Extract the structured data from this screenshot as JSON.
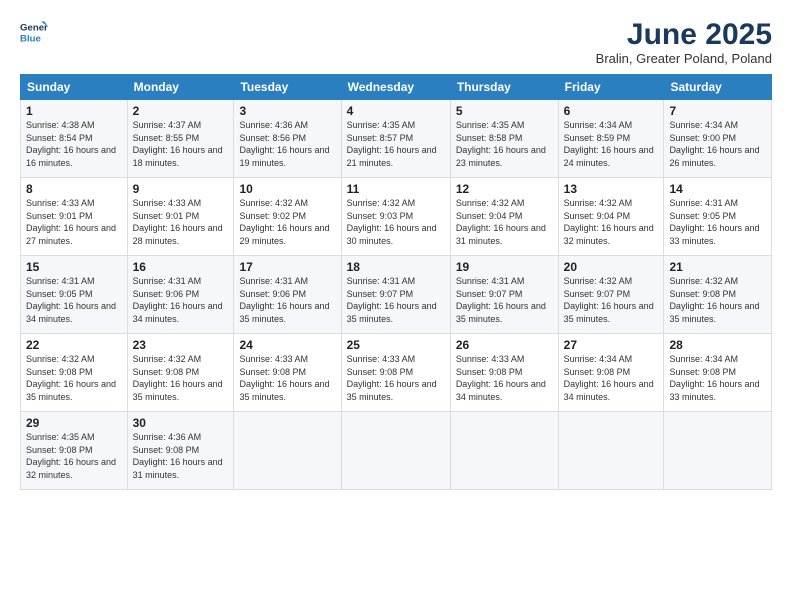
{
  "logo": {
    "line1": "General",
    "line2": "Blue"
  },
  "title": "June 2025",
  "subtitle": "Bralin, Greater Poland, Poland",
  "weekdays": [
    "Sunday",
    "Monday",
    "Tuesday",
    "Wednesday",
    "Thursday",
    "Friday",
    "Saturday"
  ],
  "weeks": [
    [
      {
        "day": "1",
        "sunrise": "Sunrise: 4:38 AM",
        "sunset": "Sunset: 8:54 PM",
        "daylight": "Daylight: 16 hours and 16 minutes."
      },
      {
        "day": "2",
        "sunrise": "Sunrise: 4:37 AM",
        "sunset": "Sunset: 8:55 PM",
        "daylight": "Daylight: 16 hours and 18 minutes."
      },
      {
        "day": "3",
        "sunrise": "Sunrise: 4:36 AM",
        "sunset": "Sunset: 8:56 PM",
        "daylight": "Daylight: 16 hours and 19 minutes."
      },
      {
        "day": "4",
        "sunrise": "Sunrise: 4:35 AM",
        "sunset": "Sunset: 8:57 PM",
        "daylight": "Daylight: 16 hours and 21 minutes."
      },
      {
        "day": "5",
        "sunrise": "Sunrise: 4:35 AM",
        "sunset": "Sunset: 8:58 PM",
        "daylight": "Daylight: 16 hours and 23 minutes."
      },
      {
        "day": "6",
        "sunrise": "Sunrise: 4:34 AM",
        "sunset": "Sunset: 8:59 PM",
        "daylight": "Daylight: 16 hours and 24 minutes."
      },
      {
        "day": "7",
        "sunrise": "Sunrise: 4:34 AM",
        "sunset": "Sunset: 9:00 PM",
        "daylight": "Daylight: 16 hours and 26 minutes."
      }
    ],
    [
      {
        "day": "8",
        "sunrise": "Sunrise: 4:33 AM",
        "sunset": "Sunset: 9:01 PM",
        "daylight": "Daylight: 16 hours and 27 minutes."
      },
      {
        "day": "9",
        "sunrise": "Sunrise: 4:33 AM",
        "sunset": "Sunset: 9:01 PM",
        "daylight": "Daylight: 16 hours and 28 minutes."
      },
      {
        "day": "10",
        "sunrise": "Sunrise: 4:32 AM",
        "sunset": "Sunset: 9:02 PM",
        "daylight": "Daylight: 16 hours and 29 minutes."
      },
      {
        "day": "11",
        "sunrise": "Sunrise: 4:32 AM",
        "sunset": "Sunset: 9:03 PM",
        "daylight": "Daylight: 16 hours and 30 minutes."
      },
      {
        "day": "12",
        "sunrise": "Sunrise: 4:32 AM",
        "sunset": "Sunset: 9:04 PM",
        "daylight": "Daylight: 16 hours and 31 minutes."
      },
      {
        "day": "13",
        "sunrise": "Sunrise: 4:32 AM",
        "sunset": "Sunset: 9:04 PM",
        "daylight": "Daylight: 16 hours and 32 minutes."
      },
      {
        "day": "14",
        "sunrise": "Sunrise: 4:31 AM",
        "sunset": "Sunset: 9:05 PM",
        "daylight": "Daylight: 16 hours and 33 minutes."
      }
    ],
    [
      {
        "day": "15",
        "sunrise": "Sunrise: 4:31 AM",
        "sunset": "Sunset: 9:05 PM",
        "daylight": "Daylight: 16 hours and 34 minutes."
      },
      {
        "day": "16",
        "sunrise": "Sunrise: 4:31 AM",
        "sunset": "Sunset: 9:06 PM",
        "daylight": "Daylight: 16 hours and 34 minutes."
      },
      {
        "day": "17",
        "sunrise": "Sunrise: 4:31 AM",
        "sunset": "Sunset: 9:06 PM",
        "daylight": "Daylight: 16 hours and 35 minutes."
      },
      {
        "day": "18",
        "sunrise": "Sunrise: 4:31 AM",
        "sunset": "Sunset: 9:07 PM",
        "daylight": "Daylight: 16 hours and 35 minutes."
      },
      {
        "day": "19",
        "sunrise": "Sunrise: 4:31 AM",
        "sunset": "Sunset: 9:07 PM",
        "daylight": "Daylight: 16 hours and 35 minutes."
      },
      {
        "day": "20",
        "sunrise": "Sunrise: 4:32 AM",
        "sunset": "Sunset: 9:07 PM",
        "daylight": "Daylight: 16 hours and 35 minutes."
      },
      {
        "day": "21",
        "sunrise": "Sunrise: 4:32 AM",
        "sunset": "Sunset: 9:08 PM",
        "daylight": "Daylight: 16 hours and 35 minutes."
      }
    ],
    [
      {
        "day": "22",
        "sunrise": "Sunrise: 4:32 AM",
        "sunset": "Sunset: 9:08 PM",
        "daylight": "Daylight: 16 hours and 35 minutes."
      },
      {
        "day": "23",
        "sunrise": "Sunrise: 4:32 AM",
        "sunset": "Sunset: 9:08 PM",
        "daylight": "Daylight: 16 hours and 35 minutes."
      },
      {
        "day": "24",
        "sunrise": "Sunrise: 4:33 AM",
        "sunset": "Sunset: 9:08 PM",
        "daylight": "Daylight: 16 hours and 35 minutes."
      },
      {
        "day": "25",
        "sunrise": "Sunrise: 4:33 AM",
        "sunset": "Sunset: 9:08 PM",
        "daylight": "Daylight: 16 hours and 35 minutes."
      },
      {
        "day": "26",
        "sunrise": "Sunrise: 4:33 AM",
        "sunset": "Sunset: 9:08 PM",
        "daylight": "Daylight: 16 hours and 34 minutes."
      },
      {
        "day": "27",
        "sunrise": "Sunrise: 4:34 AM",
        "sunset": "Sunset: 9:08 PM",
        "daylight": "Daylight: 16 hours and 34 minutes."
      },
      {
        "day": "28",
        "sunrise": "Sunrise: 4:34 AM",
        "sunset": "Sunset: 9:08 PM",
        "daylight": "Daylight: 16 hours and 33 minutes."
      }
    ],
    [
      {
        "day": "29",
        "sunrise": "Sunrise: 4:35 AM",
        "sunset": "Sunset: 9:08 PM",
        "daylight": "Daylight: 16 hours and 32 minutes."
      },
      {
        "day": "30",
        "sunrise": "Sunrise: 4:36 AM",
        "sunset": "Sunset: 9:08 PM",
        "daylight": "Daylight: 16 hours and 31 minutes."
      },
      null,
      null,
      null,
      null,
      null
    ]
  ]
}
